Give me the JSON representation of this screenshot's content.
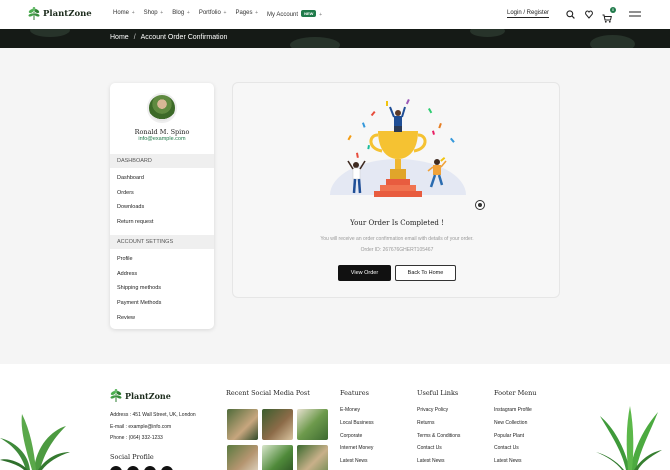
{
  "header": {
    "brand": "PlantZone",
    "nav": [
      {
        "label": "Home",
        "chev": "+"
      },
      {
        "label": "Shop",
        "chev": "+"
      },
      {
        "label": "Blog",
        "chev": "+"
      },
      {
        "label": "Portfolio",
        "chev": "+"
      },
      {
        "label": "Pages",
        "chev": "+"
      },
      {
        "label": "My Account",
        "badge": "NEW",
        "chev": "+"
      }
    ],
    "login_label": "Login / Register",
    "cart_count": "0",
    "icons": [
      "search-icon",
      "heart-icon",
      "cart-icon",
      "menu-icon"
    ]
  },
  "breadcrumb": {
    "home": "Home",
    "sep": "/",
    "current": "Account Order Confirmation"
  },
  "sidebar": {
    "name": "Ronald M. Spino",
    "email": "info@example.com",
    "dashboard_heading": "DASHBOARD",
    "dashboard_items": [
      "Dashboard",
      "Orders",
      "Downloads",
      "Return request"
    ],
    "settings_heading": "ACCOUNT SETTINGS",
    "settings_items": [
      "Profile",
      "Address",
      "Shipping methods",
      "Payment Methods",
      "Review"
    ]
  },
  "confirmation": {
    "title": "Your Order Is Completed !",
    "message": "You will receive an order confirmation email with details of your order.",
    "order_id": "Order ID: 267676GHERT105467",
    "view_label": "View Order",
    "back_label": "Back To Home"
  },
  "footer": {
    "brand": "PlantZone",
    "address": "Address : 451 Wall Street, UK, London",
    "email": "E-mail : example@info.com",
    "phone": "Phone : (064) 332-1233",
    "social_heading": "Social Profile",
    "recent_heading": "Recent Social Media Post",
    "columns": [
      {
        "title": "Features",
        "links": [
          "E-Money",
          "Local Business",
          "Corporate",
          "Internet Money",
          "Latest News"
        ]
      },
      {
        "title": "Useful Links",
        "links": [
          "Privacy Policy",
          "Returns",
          "Terms & Conditions",
          "Contact Us",
          "Latest News"
        ]
      },
      {
        "title": "Footer Menu",
        "links": [
          "Instagram Profile",
          "New Collection",
          "Popular Plant",
          "Contact Us",
          "Latest News"
        ]
      }
    ]
  },
  "colors": {
    "accent": "#1f7a4a",
    "dark": "#111111",
    "banner": "#151a16"
  }
}
